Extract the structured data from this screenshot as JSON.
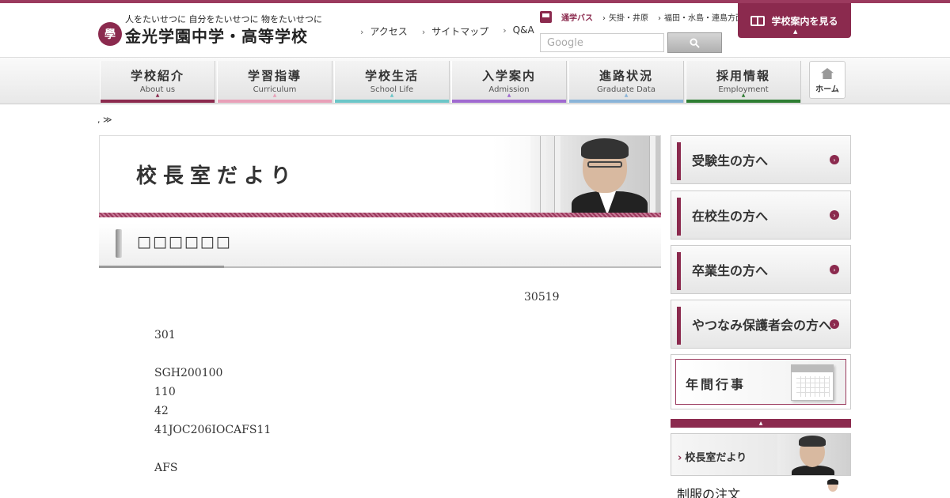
{
  "colors": {
    "accent": "#8b2a4e",
    "nav_bars": [
      "#8b2a4e",
      "#e8a0b8",
      "#6cc6c8",
      "#a06ad0",
      "#8ab4d8",
      "#2e7d32"
    ]
  },
  "logo": {
    "tagline": "人をたいせつに 自分をたいせつに 物をたいせつに",
    "name": "金光学園中学・高等学校",
    "mark": "學"
  },
  "header_links": [
    "アクセス",
    "サイトマップ",
    "Q&A"
  ],
  "bus": {
    "label": "通学バス",
    "routes": [
      "矢掛・井原",
      "福田・水島・連島方面"
    ]
  },
  "search": {
    "placeholder": "Google"
  },
  "guide_button": {
    "label": "学校案内を見る"
  },
  "nav": [
    {
      "jp": "学校紹介",
      "en": "About us"
    },
    {
      "jp": "学習指導",
      "en": "Curriculum"
    },
    {
      "jp": "学校生活",
      "en": "School Life"
    },
    {
      "jp": "入学案内",
      "en": "Admission"
    },
    {
      "jp": "進路状況",
      "en": "Graduate Data"
    },
    {
      "jp": "採用情報",
      "en": "Employment"
    }
  ],
  "home_label": "ホーム",
  "breadcrumb": ", ≫",
  "banner_title": "校長室だより",
  "subhead": "□□□□□□",
  "body_lines": [
    "30519",
    "301",
    "SGH200100",
    "110",
    "42",
    "41JOC206IOCAFS11",
    "AFS"
  ],
  "sidebar": [
    {
      "label": "受験生の方へ"
    },
    {
      "label": "在校生の方へ"
    },
    {
      "label": "卒業生の方へ"
    },
    {
      "label": "やつなみ保護者会の方へ"
    }
  ],
  "calendar_label": "年間行事",
  "principal_label": "校長室だより",
  "uniform_label": "制服の注文"
}
